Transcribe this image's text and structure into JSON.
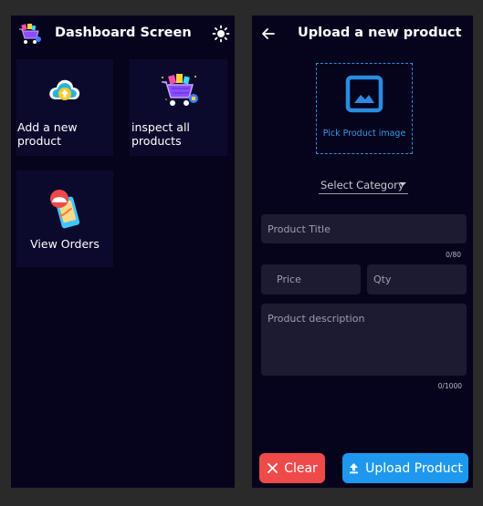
{
  "left_screen": {
    "appbar": {
      "title": "Dashboard Screen",
      "logo_icon": "shopping-cart-logo-icon",
      "theme_toggle_icon": "sun-icon"
    },
    "tiles": [
      {
        "label_line1": "Add a new",
        "label_line2": "product",
        "icon": "cloud-upload-icon"
      },
      {
        "label_line1": "inspect all",
        "label_line2": "products",
        "icon": "shopping-cart-icon"
      },
      {
        "label": "View Orders",
        "icon": "phone-orders-icon"
      }
    ]
  },
  "right_screen": {
    "appbar": {
      "title": "Upload a new product",
      "back_icon": "arrow-left-icon"
    },
    "image_picker": {
      "label": "Pick Product image",
      "icon": "image-icon"
    },
    "category_dropdown": {
      "selected": "Select Category",
      "icon": "caret-down-icon"
    },
    "fields": {
      "title": {
        "placeholder": "Product Title",
        "value": "",
        "counter": "0/80"
      },
      "price": {
        "placeholder": "Price",
        "value": ""
      },
      "qty": {
        "placeholder": "Qty",
        "value": ""
      },
      "description": {
        "placeholder": "Product description",
        "value": "",
        "counter": "0/1000"
      }
    },
    "buttons": {
      "clear": {
        "label": "Clear",
        "icon": "close-icon"
      },
      "upload": {
        "label": "Upload Product",
        "icon": "upload-icon"
      }
    }
  },
  "colors": {
    "background": "#2a2a2a",
    "screen": "#06041d",
    "tile": "#0c0a2c",
    "field": "#1d1b32",
    "accent_blue": "#1e98ee",
    "danger_red": "#ef4a4a"
  }
}
